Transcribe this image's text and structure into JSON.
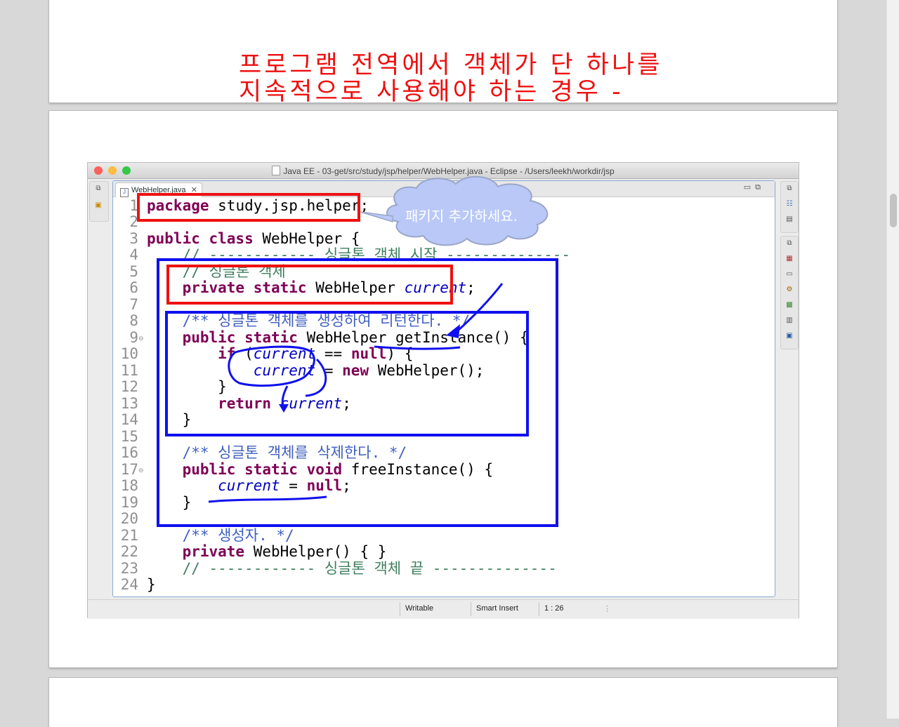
{
  "slide_prev": {
    "title_line1": "프로그램 전역에서 객체가 단 하나를",
    "title_line2": "지속적으로 사용해야 하는 경우 -"
  },
  "window": {
    "title": "Java EE - 03-get/src/study/jsp/helper/WebHelper.java - Eclipse - /Users/leekh/workdir/jsp"
  },
  "editor": {
    "tab_label": "WebHelper.java",
    "line_numbers": [
      "1",
      "2",
      "3",
      "4",
      "5",
      "6",
      "7",
      "8",
      "9",
      "10",
      "11",
      "12",
      "13",
      "14",
      "15",
      "16",
      "17",
      "18",
      "19",
      "20",
      "21",
      "22",
      "23",
      "24"
    ],
    "tokens": {
      "l1_kw": "package",
      "l1_rest": " study.jsp.helper;",
      "l3_kw": "public class",
      "l3_rest": " WebHelper {",
      "l4": "    // ------------ 싱글톤 객체 시작 --------------",
      "l5": "    // 싱글톤 객체",
      "l6_kw": "    private static",
      "l6_type": " WebHelper ",
      "l6_fld": "current",
      "l6_end": ";",
      "l8": "    /** 싱글톤 객체를 생성하여 리턴한다. */",
      "l9_kw": "    public static",
      "l9_rest": " WebHelper getInstance() {",
      "l10_kw": "        if",
      "l10_a": " (",
      "l10_fld": "current",
      "l10_b": " == ",
      "l10_kw2": "null",
      "l10_c": ") {",
      "l11_fld": "            current",
      "l11_a": " = ",
      "l11_kw": "new",
      "l11_b": " WebHelper();",
      "l12": "        }",
      "l13_kw": "        return",
      "l13_sp": " ",
      "l13_fld": "current",
      "l13_end": ";",
      "l14": "    }",
      "l16": "    /** 싱글톤 객체를 삭제한다. */",
      "l17_kw": "    public static void",
      "l17_rest": " freeInstance() {",
      "l18_fld": "        current",
      "l18_a": " = ",
      "l18_kw": "null",
      "l18_end": ";",
      "l19": "    }",
      "l21": "    /** 생성자. */",
      "l22_kw": "    private",
      "l22_rest": " WebHelper() { }",
      "l23": "    // ------------ 싱글톤 객체 끝 --------------",
      "l24": "}"
    }
  },
  "callout": "패키지 추가하세요.",
  "status": {
    "writable": "Writable",
    "insert_mode": "Smart Insert",
    "cursor_pos": "1 : 26"
  },
  "colors": {
    "annotation_red": "#ee1111",
    "annotation_blue": "#1010ee",
    "callout_fill": "#b9c8f7"
  }
}
